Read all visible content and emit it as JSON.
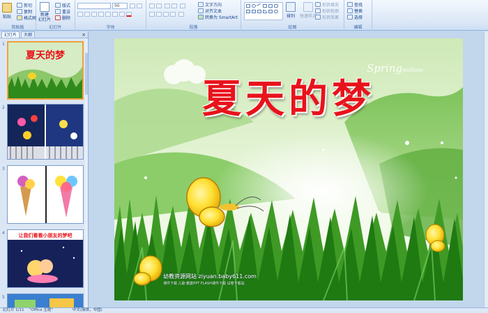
{
  "ribbon": {
    "clipboard": {
      "paste": "粘贴",
      "cut": "剪切",
      "copy": "复制",
      "format_painter": "格式刷",
      "group": "剪贴板"
    },
    "slides": {
      "new_slide": "新建\n幻灯片",
      "layout": "版式",
      "reset": "重设",
      "delete": "删除",
      "group": "幻灯片"
    },
    "font": {
      "size": "96",
      "group": "字体"
    },
    "paragraph": {
      "text_direction": "文字方向",
      "align_text": "对齐文本",
      "convert_smartart": "转换为 SmartArt",
      "group": "段落"
    },
    "drawing": {
      "arrange": "排列",
      "quick_styles": "快速样式",
      "fill": "形状填充",
      "outline": "形状轮廓",
      "effects": "形状效果",
      "group": "绘图"
    },
    "editing": {
      "find": "查找",
      "replace": "替换",
      "select": "选择",
      "group": "编辑"
    }
  },
  "pane": {
    "tab_slides": "幻灯片",
    "tab_outline": "大纲",
    "close": "×",
    "slide_numbers": [
      "1",
      "2",
      "3",
      "4",
      "5"
    ],
    "thumb1_title": "夏天的梦",
    "thumb4_title": "让我们看看小朋友的梦吧"
  },
  "slide": {
    "title": "夏天的梦",
    "spring_text": "Spring",
    "spring_small": "wallose",
    "watermark_line1": "幼教资源网站  ziyuan.baby611.com",
    "watermark_line2": "课件下载   儿歌   教案PPT   FLASH课件下载   试卷下载站"
  },
  "status": {
    "slide_pos": "幻灯片 1/11",
    "theme": "\"Office 主题\"",
    "language": "中文(简体，中国)"
  },
  "colors": {
    "title_red": "#e8131b",
    "ribbon_blue": "#dce8f7",
    "selected_thumb": "#f0a23a"
  }
}
